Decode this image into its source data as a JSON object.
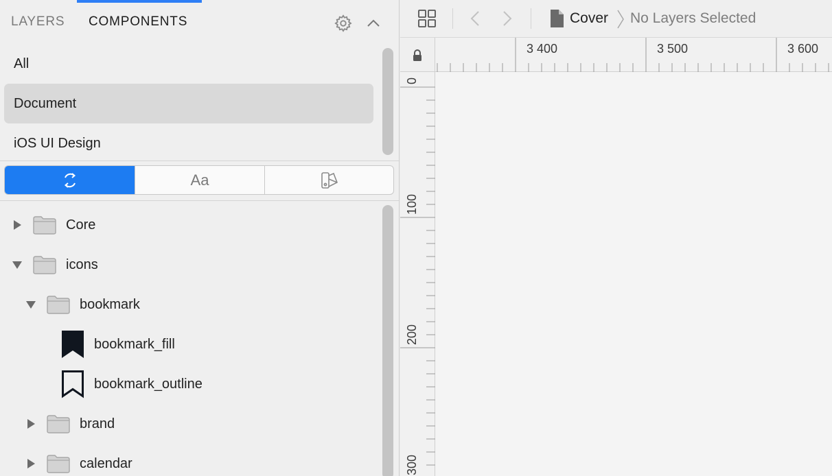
{
  "sidebar": {
    "tabs": [
      {
        "label": "LAYERS",
        "active": false
      },
      {
        "label": "COMPONENTS",
        "active": true
      }
    ],
    "libraries": [
      {
        "label": "All",
        "selected": false
      },
      {
        "label": "Document",
        "selected": true
      },
      {
        "label": "iOS UI Design",
        "selected": false
      }
    ],
    "segments": [
      {
        "name": "symbols",
        "icon": "symbols-icon",
        "selected": true
      },
      {
        "name": "text-styles",
        "label": "Aa",
        "selected": false
      },
      {
        "name": "layer-styles",
        "icon": "layer-styles-icon",
        "selected": false
      }
    ],
    "tree": [
      {
        "label": "Core",
        "type": "folder",
        "expanded": false,
        "level": 0
      },
      {
        "label": "icons",
        "type": "folder",
        "expanded": true,
        "level": 0
      },
      {
        "label": "bookmark",
        "type": "folder",
        "expanded": true,
        "level": 1
      },
      {
        "label": "bookmark_fill",
        "type": "symbol",
        "icon": "bookmark-fill-icon",
        "level": 2
      },
      {
        "label": "bookmark_outline",
        "type": "symbol",
        "icon": "bookmark-outline-icon",
        "level": 2
      },
      {
        "label": "brand",
        "type": "folder",
        "expanded": false,
        "level": 1
      },
      {
        "label": "calendar",
        "type": "folder",
        "expanded": false,
        "level": 1
      }
    ]
  },
  "toolbar": {
    "page": "Cover",
    "selection": "No Layers Selected"
  },
  "rulers": {
    "horizontal": [
      "3 400",
      "3 500",
      "3 600"
    ],
    "vertical": [
      "0",
      "100",
      "200",
      "300"
    ]
  },
  "colors": {
    "accent": "#2f7ff6",
    "selected_segment": "#1d7cf2",
    "selected_row": "#d9d9d9"
  }
}
